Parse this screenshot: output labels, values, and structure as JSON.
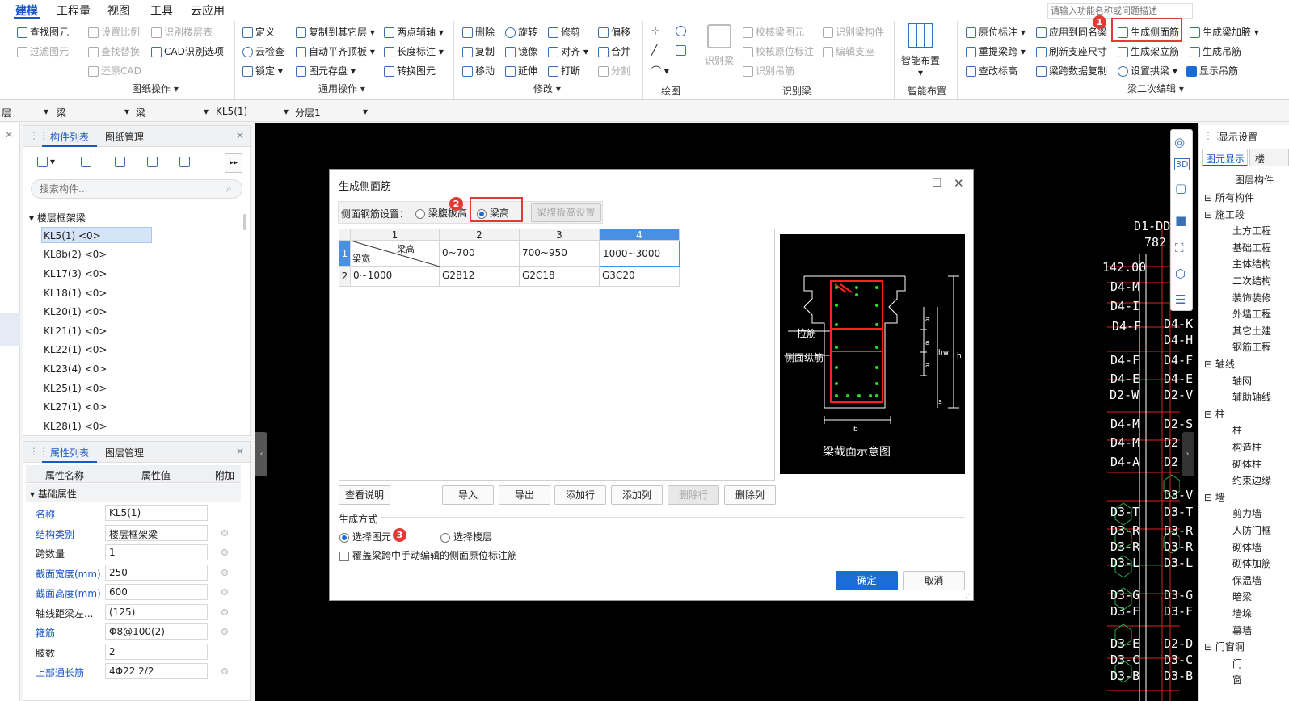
{
  "ribbon": {
    "tabs": [
      "建模",
      "工程量",
      "视图",
      "工具",
      "云应用"
    ],
    "search_placeholder": "请输入功能名称或问题描述",
    "drawing_ops": {
      "items": [
        "查找图元",
        "设置比例",
        "识别楼层表",
        "过滤图元",
        "查找替换",
        "CAD识别选项",
        "还原CAD"
      ],
      "group": "图纸操作"
    },
    "common_ops": {
      "items": [
        "定义",
        "复制到其它层",
        "两点辅轴",
        "云检查",
        "自动平齐顶板",
        "长度标注",
        "锁定",
        "图元存盘",
        "转换图元"
      ],
      "group": "通用操作"
    },
    "modify": {
      "items": [
        "删除",
        "旋转",
        "修剪",
        "偏移",
        "复制",
        "镜像",
        "对齐",
        "合并",
        "移动",
        "延伸",
        "打断",
        "分割"
      ],
      "group": "修改"
    },
    "draw": {
      "group": "绘图"
    },
    "recognize_beam": {
      "items": [
        "识别梁",
        "校核梁图元",
        "识别梁构件",
        "校核原位标注",
        "编辑支座",
        "识别吊筋"
      ],
      "group": "识别梁"
    },
    "smart_layout": {
      "label": "智能布置",
      "group": "智能布置"
    },
    "beam_edit": {
      "items": [
        "原位标注",
        "应用到同名梁",
        "生成侧面筋",
        "生成梁加腋",
        "重提梁跨",
        "刷新支座尺寸",
        "生成架立筋",
        "生成吊筋",
        "查改标高",
        "梁跨数据复制",
        "设置拱梁",
        "显示吊筋"
      ],
      "group": "梁二次编辑"
    }
  },
  "selectors": [
    "层",
    "梁",
    "梁",
    "KL5(1)",
    "分层1"
  ],
  "component_list": {
    "tabs": [
      "构件列表",
      "图纸管理"
    ],
    "search_placeholder": "搜索构件...",
    "category": "楼层框架梁",
    "items": [
      "KL5(1) <0>",
      "KL8b(2) <0>",
      "KL17(3) <0>",
      "KL18(1) <0>",
      "KL20(1) <0>",
      "KL21(1) <0>",
      "KL22(1) <0>",
      "KL23(4) <0>",
      "KL25(1) <0>",
      "KL27(1) <0>",
      "KL28(1) <0>"
    ]
  },
  "property_list": {
    "tabs": [
      "属性列表",
      "图层管理"
    ],
    "headers": [
      "属性名称",
      "属性值",
      "附加"
    ],
    "section": "基础属性",
    "rows": [
      {
        "name": "名称",
        "value": "KL5(1)"
      },
      {
        "name": "结构类别",
        "value": "楼层框架梁"
      },
      {
        "name": "跨数量",
        "value": "1"
      },
      {
        "name": "截面宽度(mm)",
        "value": "250"
      },
      {
        "name": "截面高度(mm)",
        "value": "600"
      },
      {
        "name": "轴线距梁左...",
        "value": "(125)"
      },
      {
        "name": "箍筋",
        "value": "Φ8@100(2)"
      },
      {
        "name": "肢数",
        "value": "2"
      },
      {
        "name": "上部通长筋",
        "value": "4Φ22 2/2"
      }
    ]
  },
  "display_settings": {
    "title": "显示设置",
    "tabs": [
      "图元显示",
      "楼"
    ],
    "header": "图层构件",
    "tree": [
      "所有构件",
      "施工段",
      "土方工程",
      "基础工程",
      "主体结构",
      "二次结构",
      "装饰装修",
      "外墙工程",
      "其它土建",
      "钢筋工程",
      "轴线",
      "轴网",
      "辅助轴线",
      "柱",
      "柱",
      "构造柱",
      "砌体柱",
      "约束边缘",
      "墙",
      "剪力墙",
      "人防门框",
      "砌体墙",
      "砌体加筋",
      "保温墙",
      "暗梁",
      "墙垛",
      "幕墙",
      "门窗洞",
      "门",
      "窗"
    ]
  },
  "dialog": {
    "title": "生成侧面筋",
    "setting_label": "侧面钢筋设置：",
    "option_web_height": "梁腹板高",
    "option_beam_height": "梁高",
    "web_settings_button": "梁腹板高设置",
    "table": {
      "col_numbers": [
        "1",
        "2",
        "3",
        "4"
      ],
      "corner_top": "梁高",
      "corner_bottom": "梁宽",
      "header_row": [
        "0~700",
        "700~950",
        "1000~3000"
      ],
      "data_row": {
        "width": "0~1000",
        "values": [
          "G2B12",
          "G2C18",
          "G3C20"
        ]
      }
    },
    "buttons": [
      "查看说明",
      "导入",
      "导出",
      "添加行",
      "添加列",
      "删除行",
      "删除列"
    ],
    "diagram": {
      "caption": "梁截面示意图",
      "label_tie": "拉筋",
      "label_side": "侧面纵筋",
      "dims": [
        "a",
        "a",
        "a",
        "hw",
        "h",
        "s",
        "b"
      ]
    },
    "generate_section": "生成方式",
    "gen_option_select_element": "选择图元",
    "gen_option_select_floor": "选择楼层",
    "overwrite_checkbox": "覆盖梁跨中手动编辑的侧面原位标注筋",
    "ok": "确定",
    "cancel": "取消"
  },
  "annotations": [
    "1",
    "2",
    "3"
  ],
  "cad_labels": [
    "D1-DD",
    "782",
    "142.00",
    "D4-M",
    "D4-I",
    "D4-F",
    "D4-E",
    "D2-W",
    "D4-A",
    "D2-S",
    "D3-V",
    "D3-T",
    "D3-R",
    "D3-L",
    "D3-G",
    "D3-F",
    "D3-E",
    "D2-D",
    "D3-C",
    "D3-B",
    "D2",
    "D2-V",
    "D4-K",
    "D4-H"
  ],
  "colors": {
    "accent": "#1a6dd6",
    "annotation": "#e53935",
    "canvas": "#000000"
  }
}
